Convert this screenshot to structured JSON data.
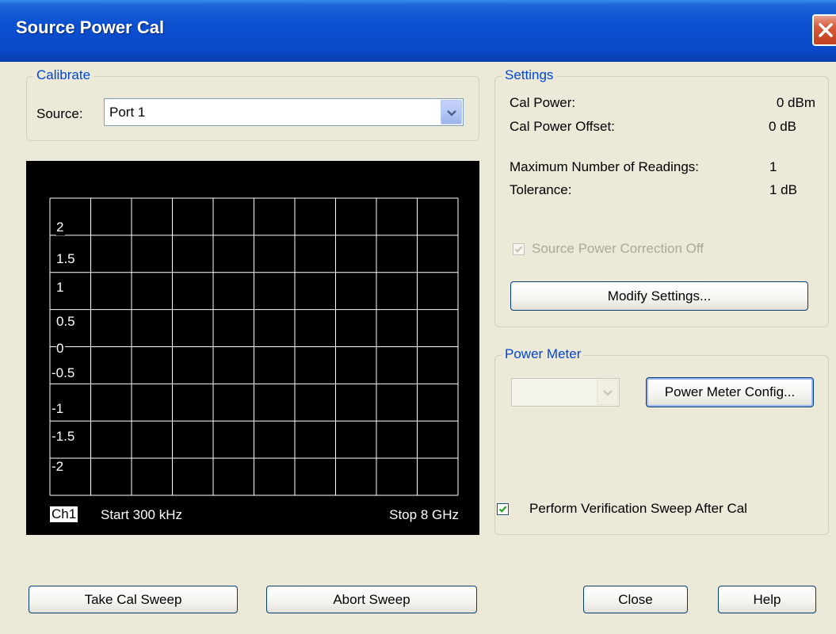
{
  "window": {
    "title": "Source Power Cal"
  },
  "calibrate": {
    "group_title": "Calibrate",
    "source_label": "Source:",
    "source_value": "Port 1"
  },
  "settings": {
    "group_title": "Settings",
    "cal_power_label": "Cal Power:",
    "cal_power_value": "0 dBm",
    "cal_power_offset_label": "Cal Power Offset:",
    "cal_power_offset_value": "0 dB",
    "max_readings_label": "Maximum Number of Readings:",
    "max_readings_value": "1",
    "tolerance_label": "Tolerance:",
    "tolerance_value": "1 dB",
    "source_power_correction_label": "Source Power Correction Off",
    "source_power_correction_checked": true,
    "modify_button": "Modify Settings..."
  },
  "power_meter": {
    "group_title": "Power Meter",
    "selected": "",
    "config_button": "Power Meter Config..."
  },
  "verification": {
    "label": "Perform Verification Sweep After Cal",
    "checked": true
  },
  "chart_data": {
    "type": "line",
    "yticks": [
      "2",
      "1.5",
      "1",
      "0.5",
      "0",
      "-0.5",
      "-1",
      "-1.5",
      "-2"
    ],
    "grid": true,
    "series": [],
    "channel": "Ch1",
    "start_label": "Start 300 kHz",
    "stop_label": "Stop 8 GHz"
  },
  "buttons": {
    "take_cal_sweep": "Take Cal Sweep",
    "abort_sweep": "Abort Sweep",
    "close": "Close",
    "help": "Help"
  },
  "colors": {
    "title_bar": "#0A48C6",
    "group_title": "#0046D5",
    "dialog_bg": "#ECE9D8",
    "plot_bg": "#000000",
    "grid": "#FFFFFF"
  }
}
